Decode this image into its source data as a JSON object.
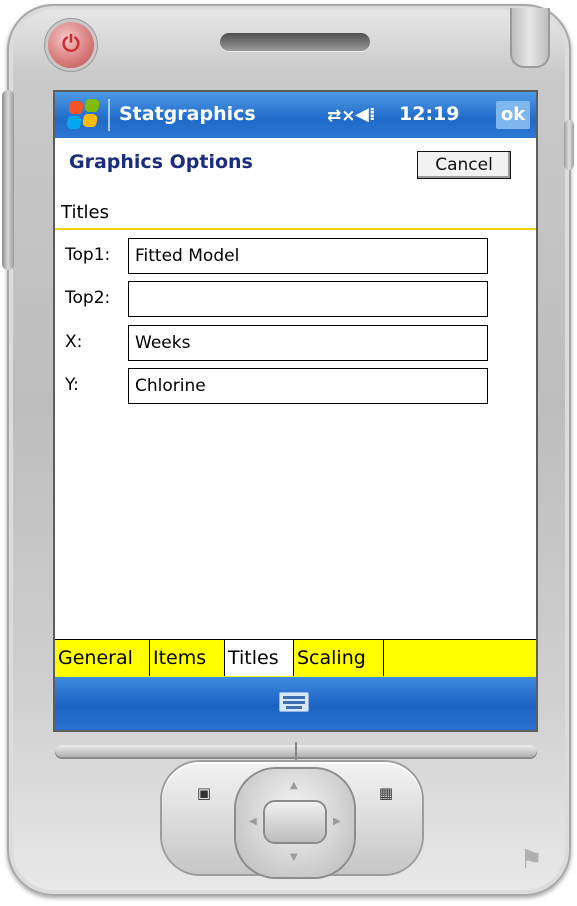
{
  "device": {
    "power_icon": "power-icon",
    "start_icon": "windows-flag-icon",
    "left_softkey_icon": "contacts-card-icon",
    "right_softkey_icon": "calendar-grid-icon"
  },
  "title_bar": {
    "app_name": "Statgraphics",
    "connectivity_icon": "connectivity-arrows-icon",
    "connectivity_glyph": "⇄×",
    "volume_icon": "speaker-icon",
    "volume_glyph": "◀⁞",
    "time": "12:19",
    "ok_label": "ok"
  },
  "header": {
    "title": "Graphics Options",
    "cancel_label": "Cancel"
  },
  "section": {
    "title": "Titles"
  },
  "fields": [
    {
      "label": "Top1:",
      "value": "Fitted Model"
    },
    {
      "label": "Top2:",
      "value": ""
    },
    {
      "label": "X:",
      "value": "Weeks"
    },
    {
      "label": "Y:",
      "value": "Chlorine"
    }
  ],
  "tabs": [
    {
      "label": "General",
      "active": false
    },
    {
      "label": "Items",
      "active": false
    },
    {
      "label": "Titles",
      "active": true
    },
    {
      "label": "Scaling",
      "active": false
    }
  ],
  "menu_bar": {
    "keyboard_icon": "keyboard-icon"
  },
  "colors": {
    "title_bar": "#1f6ac8",
    "header_text": "#1b2c7a",
    "tab_strip": "#ffff00",
    "section_rule": "#f0d000"
  }
}
